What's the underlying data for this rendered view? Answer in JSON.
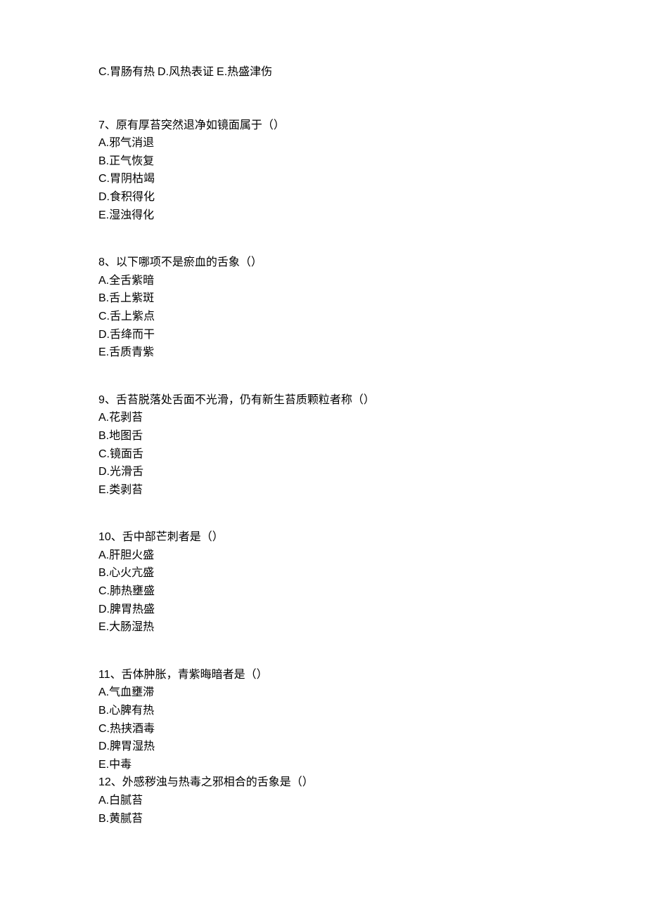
{
  "orphan": {
    "line": "C.胃肠有热 D.风热表证 E.热盛津伤",
    "c_letter": "C.",
    "c_text": "胃肠有热 ",
    "d_letter": "D.",
    "d_text": "风热表证 ",
    "e_letter": "E.",
    "e_text": "热盛津伤"
  },
  "questions": [
    {
      "num": "7",
      "text": "、原有厚苔突然退净如镜面属于（）",
      "options": [
        {
          "letter": "A.",
          "text": "邪气消退"
        },
        {
          "letter": "B.",
          "text": "正气恢复"
        },
        {
          "letter": "C.",
          "text": "胃阴枯竭"
        },
        {
          "letter": "D.",
          "text": "食积得化"
        },
        {
          "letter": "E.",
          "text": "湿浊得化"
        }
      ]
    },
    {
      "num": "8",
      "text": "、以下哪项不是瘀血的舌象（）",
      "options": [
        {
          "letter": "A.",
          "text": "全舌紫暗"
        },
        {
          "letter": "B.",
          "text": "舌上紫斑"
        },
        {
          "letter": "C.",
          "text": "舌上紫点"
        },
        {
          "letter": "D.",
          "text": "舌绛而干"
        },
        {
          "letter": "E.",
          "text": "舌质青紫"
        }
      ]
    },
    {
      "num": "9",
      "text": "、舌苔脱落处舌面不光滑，仍有新生苔质颗粒者称（）",
      "options": [
        {
          "letter": "A.",
          "text": "花剥苔"
        },
        {
          "letter": "B.",
          "text": "地图舌"
        },
        {
          "letter": "C.",
          "text": "镜面舌"
        },
        {
          "letter": "D.",
          "text": "光滑舌"
        },
        {
          "letter": "E.",
          "text": "类剥苔"
        }
      ]
    },
    {
      "num": "10",
      "text": "、舌中部芒刺者是（）",
      "options": [
        {
          "letter": "A.",
          "text": "肝胆火盛"
        },
        {
          "letter": "B.",
          "text": "心火亢盛"
        },
        {
          "letter": "C.",
          "text": "肺热壅盛"
        },
        {
          "letter": "D.",
          "text": "脾胃热盛"
        },
        {
          "letter": "E.",
          "text": "大肠湿热"
        }
      ]
    },
    {
      "num": "11",
      "text": "、舌体肿胀，青紫晦暗者是（）",
      "options": [
        {
          "letter": "A.",
          "text": "气血壅滞"
        },
        {
          "letter": "B.",
          "text": "心脾有热"
        },
        {
          "letter": "C.",
          "text": "热挟酒毒"
        },
        {
          "letter": "D.",
          "text": "脾胃湿热"
        },
        {
          "letter": "E.",
          "text": "中毒"
        }
      ],
      "tight": true
    },
    {
      "num": "12",
      "text": "、外感秽浊与热毒之邪相合的舌象是（）",
      "options": [
        {
          "letter": "A.",
          "text": "白腻苔"
        },
        {
          "letter": "B.",
          "text": "黄腻苔"
        }
      ]
    }
  ]
}
